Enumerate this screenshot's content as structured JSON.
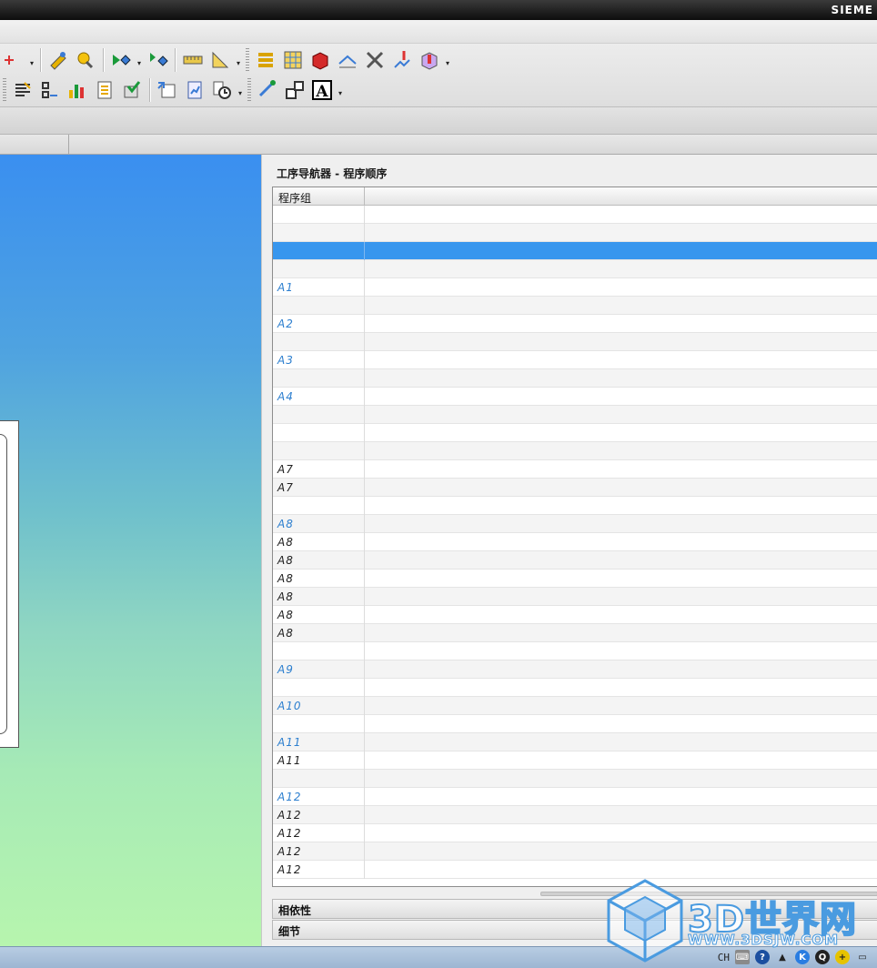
{
  "app": {
    "brand": "SIEME"
  },
  "toolbar": {
    "row1": [
      "operation-icon",
      "geometry-icon",
      "tool-icon",
      "verify-icon",
      "measure-icon",
      "angle-icon",
      "program-icon",
      "method-icon",
      "workpiece-icon",
      "path-icon",
      "tools-icon",
      "machine-icon",
      "info-icon"
    ],
    "row2": [
      "list-icon",
      "step-icon",
      "chart-icon",
      "doc-icon",
      "check-icon",
      "export-icon",
      "report-icon",
      "time-icon",
      "rotate-icon",
      "resize-icon",
      "text-icon"
    ],
    "text_icon_glyph": "A"
  },
  "navigator": {
    "title": "工序导航器 - 程序顺序",
    "column_header": "程序组",
    "selected_row": 2,
    "rows": [
      {
        "label": "",
        "link": false
      },
      {
        "label": "",
        "link": false
      },
      {
        "label": "",
        "link": false
      },
      {
        "label": "",
        "link": false
      },
      {
        "label": "A1",
        "link": true
      },
      {
        "label": "",
        "link": false
      },
      {
        "label": "A2",
        "link": true
      },
      {
        "label": "",
        "link": false
      },
      {
        "label": "A3",
        "link": true
      },
      {
        "label": "",
        "link": false
      },
      {
        "label": "A4",
        "link": true
      },
      {
        "label": "",
        "link": false
      },
      {
        "label": "",
        "link": false
      },
      {
        "label": "",
        "link": false
      },
      {
        "label": "A7",
        "link": false
      },
      {
        "label": "A7",
        "link": false
      },
      {
        "label": "",
        "link": false
      },
      {
        "label": "A8",
        "link": true
      },
      {
        "label": "A8",
        "link": false
      },
      {
        "label": "A8",
        "link": false
      },
      {
        "label": "A8",
        "link": false
      },
      {
        "label": "A8",
        "link": false
      },
      {
        "label": "A8",
        "link": false
      },
      {
        "label": "A8",
        "link": false
      },
      {
        "label": "",
        "link": false
      },
      {
        "label": "A9",
        "link": true
      },
      {
        "label": "",
        "link": false
      },
      {
        "label": "A10",
        "link": true
      },
      {
        "label": "",
        "link": false
      },
      {
        "label": "A11",
        "link": true
      },
      {
        "label": "A11",
        "link": false
      },
      {
        "label": "",
        "link": false
      },
      {
        "label": "A12",
        "link": true
      },
      {
        "label": "A12",
        "link": false
      },
      {
        "label": "A12",
        "link": false
      },
      {
        "label": "A12",
        "link": false
      },
      {
        "label": "A12",
        "link": false
      }
    ],
    "sections": {
      "dependencies": "相依性",
      "details": "细节"
    }
  },
  "taskbar": {
    "lang": "CH"
  },
  "watermark": {
    "title": "3D世界网",
    "url": "WWW.3DSJW.COM"
  },
  "colors": {
    "selection": "#3796ee",
    "link": "#2d7fcf"
  }
}
